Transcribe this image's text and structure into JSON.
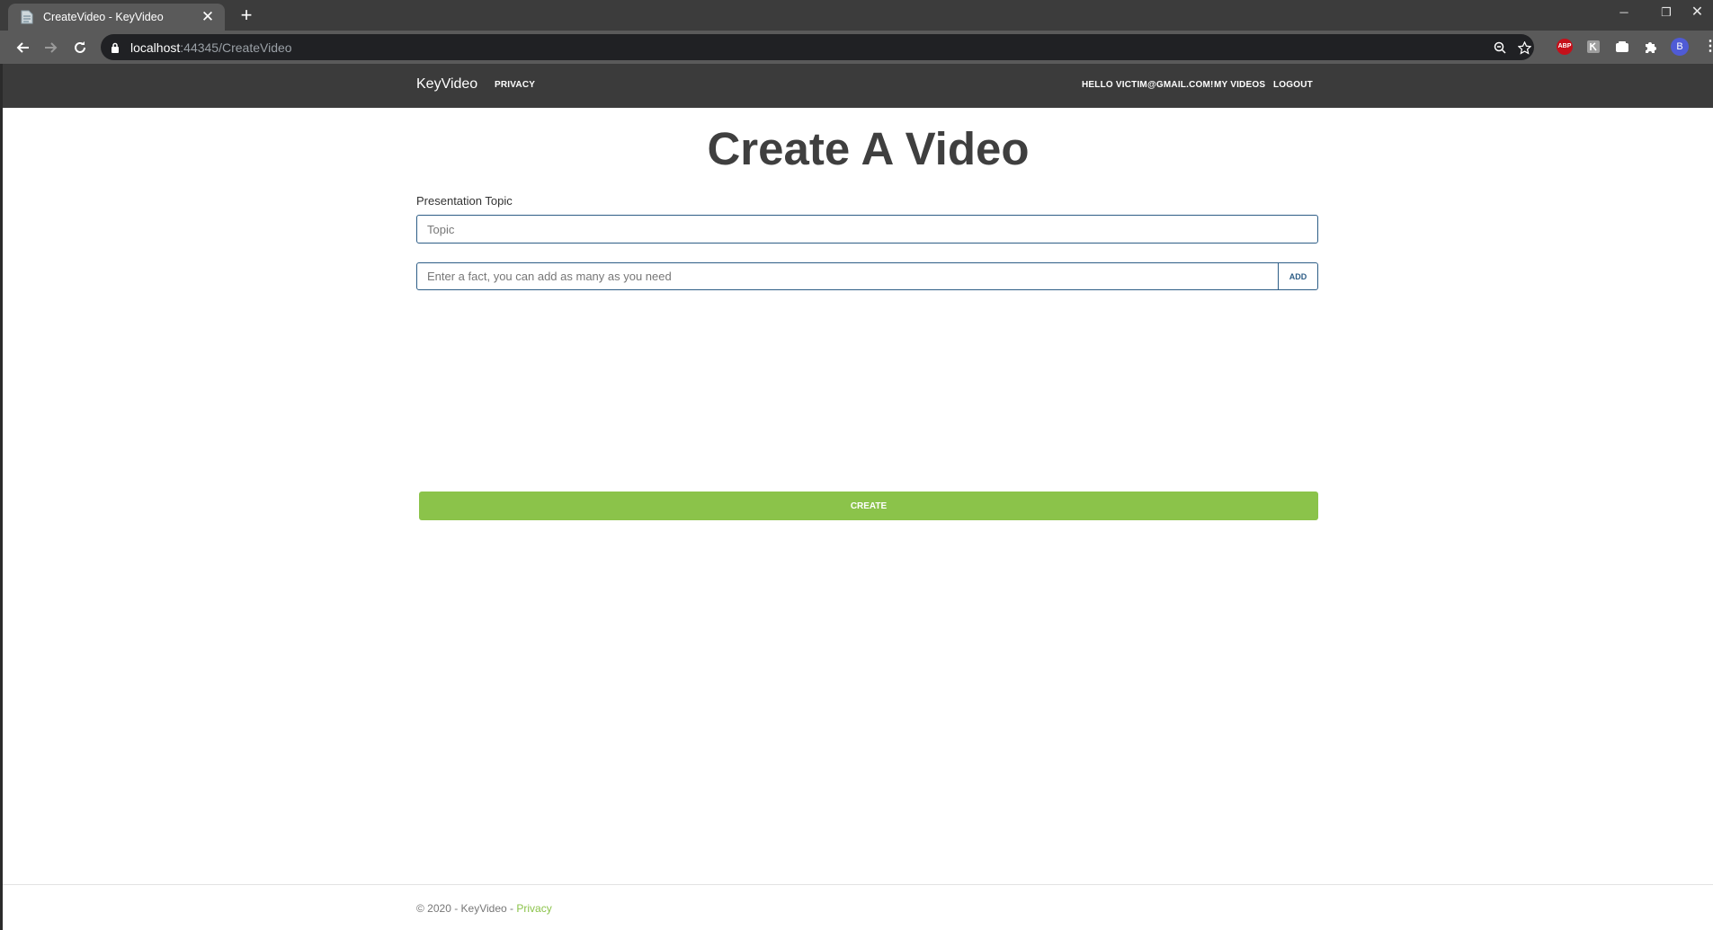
{
  "browser": {
    "tab_title": "CreateVideo - KeyVideo",
    "tab_close": "✕",
    "new_tab": "+",
    "url_host": "localhost",
    "url_rest": ":44345/CreateVideo",
    "extensions": {
      "abp_label": "ABP",
      "avatar_letter": "B"
    },
    "window_controls": {
      "minimize": "─",
      "restore": "❐",
      "close": "✕"
    }
  },
  "site_nav": {
    "brand": "KeyVideo",
    "privacy": "PRIVACY",
    "greeting": "HELLO VICTIM@GMAIL.COM!",
    "my_videos": "MY VIDEOS",
    "logout": "LOGOUT"
  },
  "main": {
    "title": "Create A Video",
    "topic_label": "Presentation Topic",
    "topic_placeholder": "Topic",
    "fact_placeholder": "Enter a fact, you can add as many as you need",
    "add_button": "ADD",
    "create_button": "CREATE"
  },
  "footer": {
    "text": "© 2020 - KeyVideo - ",
    "privacy_link": "Privacy"
  },
  "colors": {
    "accent": "#8bc34a",
    "navbar": "#3b3b3b",
    "input_border": "#2d5d86"
  }
}
